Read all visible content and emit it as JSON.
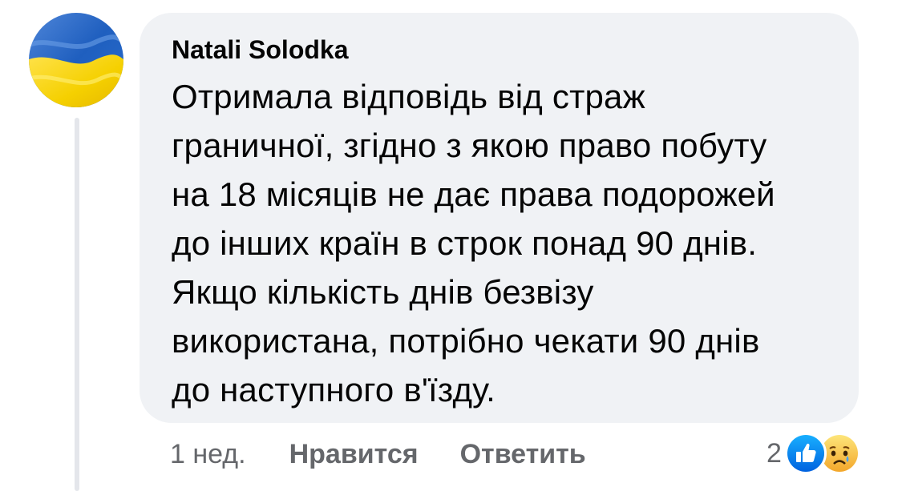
{
  "comment": {
    "author": "Natali Solodka",
    "text": "Отримала відповідь від страж\nграничної, згідно з якою право побуту\nна 18 місяців не дає права подорожей\nдо інших країн в строк понад 90 днів.\nЯкщо кількість днів безвізу\nвикористана, потрібно чекати 90 днів\nдо наступного в'їзду."
  },
  "actions": {
    "time": "1 нед.",
    "like_label": "Нравится",
    "reply_label": "Ответить"
  },
  "reactions": {
    "count": "2",
    "icons": [
      "like-icon",
      "sad-icon"
    ]
  },
  "colors": {
    "bubble": "#f0f2f5",
    "flag_blue": "#1f5fbf",
    "flag_yellow": "#f5d000",
    "like_blue": "#1877f2",
    "muted_text": "#65676b"
  }
}
